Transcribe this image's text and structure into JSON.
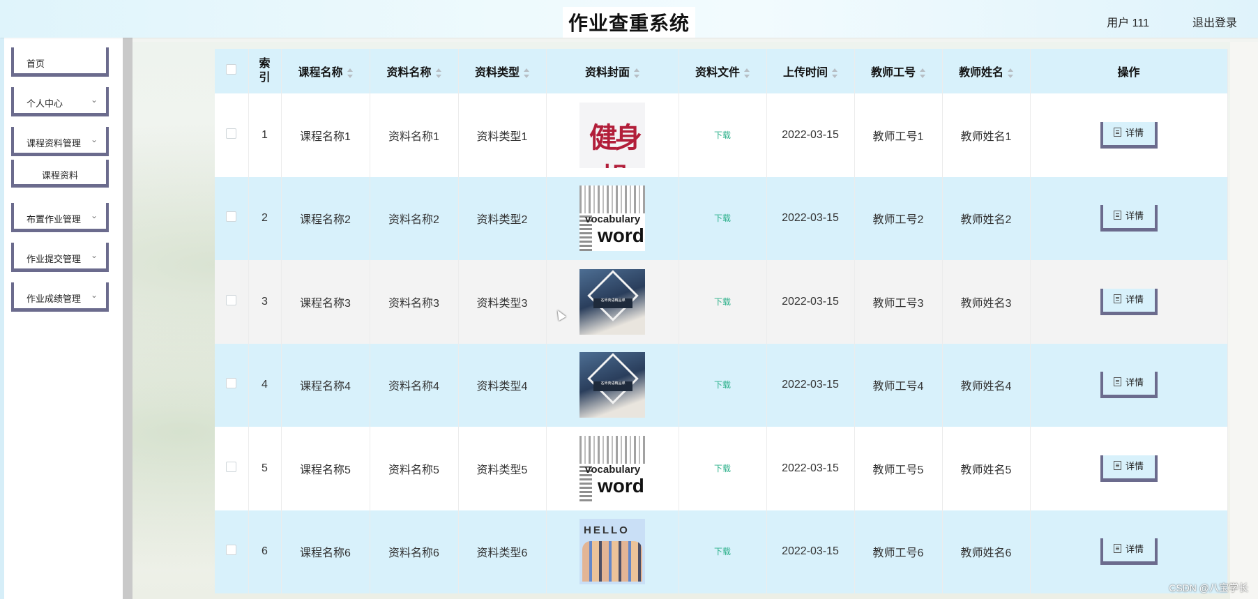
{
  "header": {
    "title": "作业查重系统",
    "user": "用户 111",
    "logout": "退出登录"
  },
  "sidebar": {
    "items": [
      {
        "label": "首页"
      },
      {
        "label": "个人中心"
      },
      {
        "label": "课程资料管理"
      },
      {
        "label": "课程资料"
      },
      {
        "label": "布置作业管理"
      },
      {
        "label": "作业提交管理"
      },
      {
        "label": "作业成绩管理"
      }
    ]
  },
  "table": {
    "columns": [
      "索引",
      "课程名称",
      "资料名称",
      "资料类型",
      "资料封面",
      "资料文件",
      "上传时间",
      "教师工号",
      "教师姓名",
      "操作"
    ],
    "download_label": "下载",
    "detail_label": "详情",
    "rows": [
      {
        "index": "1",
        "course": "课程名称1",
        "name": "资料名称1",
        "type": "资料类型1",
        "cover": "fitness",
        "time": "2022-03-15",
        "tid": "教师工号1",
        "tname": "教师姓名1"
      },
      {
        "index": "2",
        "course": "课程名称2",
        "name": "资料名称2",
        "type": "资料类型2",
        "cover": "words",
        "time": "2022-03-15",
        "tid": "教师工号2",
        "tname": "教师姓名2"
      },
      {
        "index": "3",
        "course": "课程名称3",
        "name": "资料名称3",
        "type": "资料类型3",
        "cover": "study",
        "time": "2022-03-15",
        "tid": "教师工号3",
        "tname": "教师姓名3"
      },
      {
        "index": "4",
        "course": "课程名称4",
        "name": "资料名称4",
        "type": "资料类型4",
        "cover": "study",
        "time": "2022-03-15",
        "tid": "教师工号4",
        "tname": "教师姓名4"
      },
      {
        "index": "5",
        "course": "课程名称5",
        "name": "资料名称5",
        "type": "资料类型5",
        "cover": "words",
        "time": "2022-03-15",
        "tid": "教师工号5",
        "tname": "教师姓名5"
      },
      {
        "index": "6",
        "course": "课程名称6",
        "name": "资料名称6",
        "type": "资料类型6",
        "cover": "hello",
        "time": "2022-03-15",
        "tid": "教师工号6",
        "tname": "教师姓名6"
      }
    ]
  },
  "covers": {
    "fitness_text": "健身操",
    "words_small": "vocabulary",
    "words_big": "words",
    "study_caption": "名师英语精品课",
    "hello_text": "HELLO"
  },
  "watermark": "CSDN @八宝学长",
  "colors": {
    "header_bg": "#dff4fb",
    "row_blue": "#d8f1fb",
    "menu_border": "#6b6b8d",
    "download": "#2bb08a"
  }
}
